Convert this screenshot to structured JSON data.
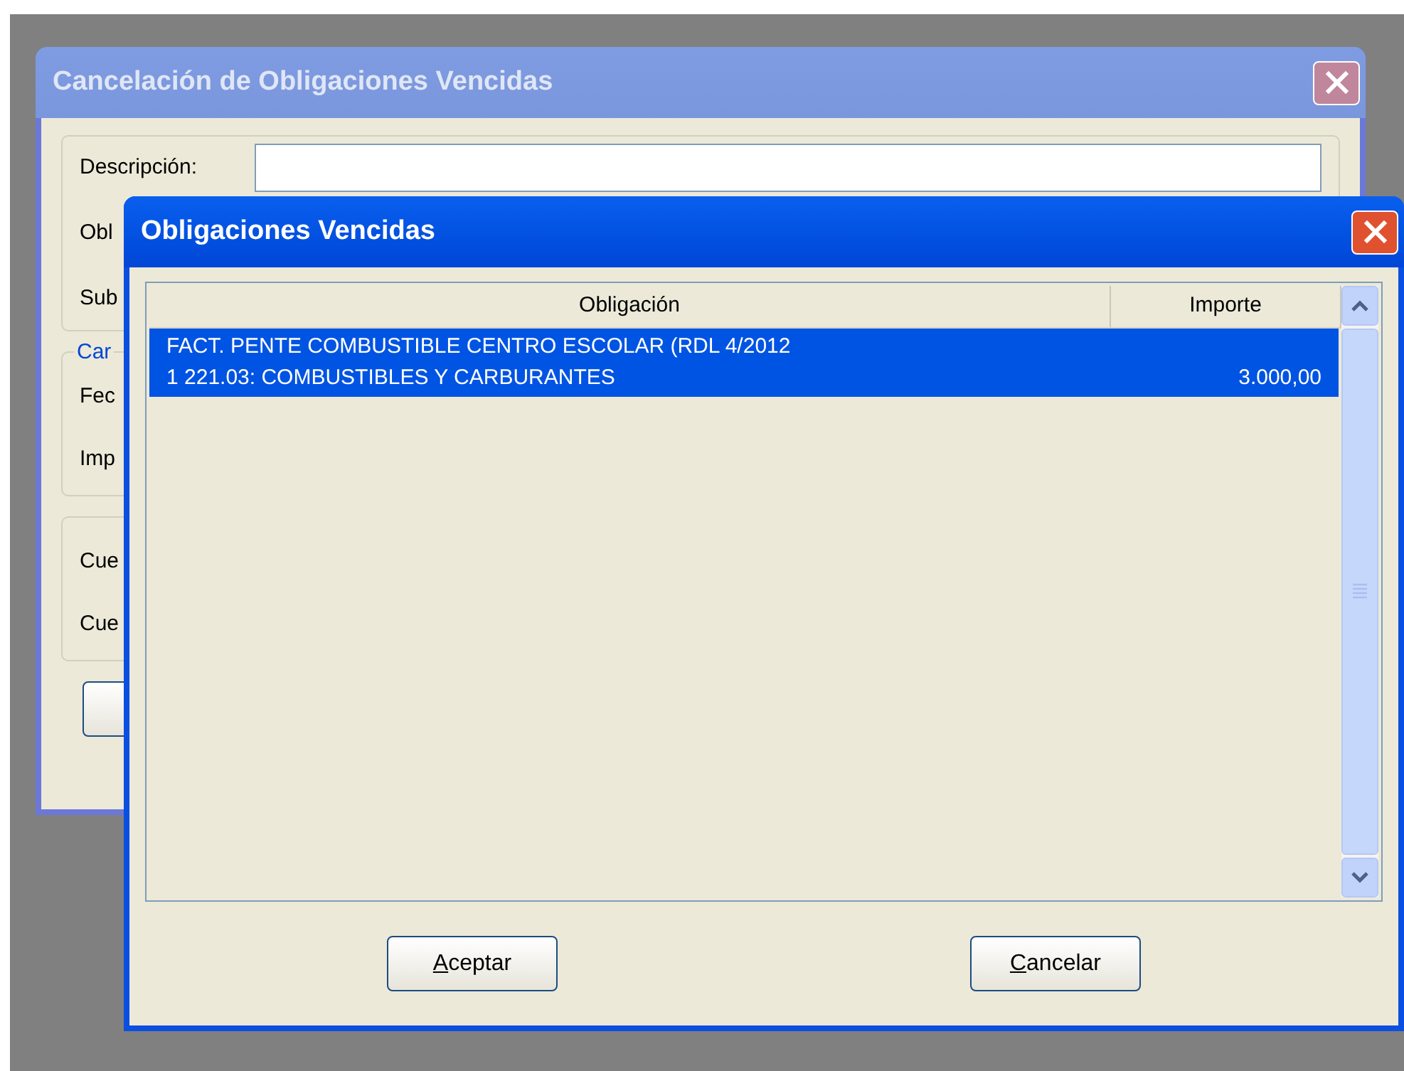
{
  "background_window": {
    "title": "Cancelación de Obligaciones Vencidas",
    "active": false,
    "fields": [
      {
        "label": "Descripción:",
        "kind": "text-field"
      },
      {
        "label": "Obl",
        "kind": "label"
      },
      {
        "label": "Sub",
        "kind": "label"
      }
    ],
    "groups": [
      {
        "legend": "Car",
        "labels": [
          "Fec",
          "Imp"
        ]
      },
      {
        "labels": [
          "Cue",
          "Cue"
        ]
      }
    ]
  },
  "dialog": {
    "title": "Obligaciones Vencidas",
    "active": true,
    "table": {
      "columns": [
        "Obligación",
        "Importe"
      ],
      "rows": [
        {
          "description": "FACT. PENTE COMBUSTIBLE CENTRO ESCOLAR (RDL 4/2012",
          "account": "1 221.03: COMBUSTIBLES Y CARBURANTES",
          "importe": "3.000,00",
          "selected": true
        }
      ]
    },
    "buttons": [
      "Aceptar",
      "Cancelar"
    ]
  }
}
